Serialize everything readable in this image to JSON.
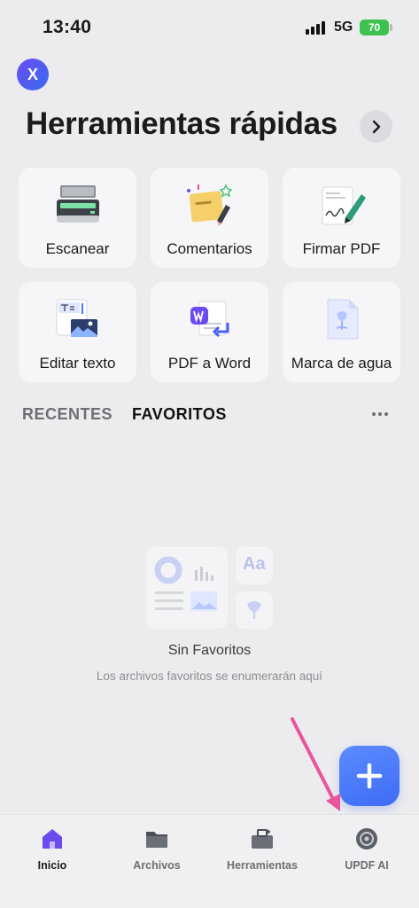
{
  "status_bar": {
    "time": "13:40",
    "network": "5G",
    "battery": "70"
  },
  "profile": {
    "initial": "X"
  },
  "header": {
    "title": "Herramientas rápidas"
  },
  "tools": [
    {
      "label": "Escanear",
      "icon": "scanner-icon"
    },
    {
      "label": "Comentarios",
      "icon": "sticky-note-icon"
    },
    {
      "label": "Firmar PDF",
      "icon": "sign-pen-icon"
    },
    {
      "label": "Editar texto",
      "icon": "edit-text-icon"
    },
    {
      "label": "PDF a Word",
      "icon": "pdf-to-word-icon"
    },
    {
      "label": "Marca de agua",
      "icon": "watermark-icon"
    }
  ],
  "tabs": {
    "recent": "RECENTES",
    "favorites": "FAVORITOS"
  },
  "empty_state": {
    "title": "Sin Favoritos",
    "subtitle": "Los archivos favoritos se enumerarán aquí",
    "illustration_text": "Aa"
  },
  "fab": {
    "icon": "plus-icon"
  },
  "tabbar": [
    {
      "label": "Inicio",
      "icon": "home-icon",
      "active": true
    },
    {
      "label": "Archivos",
      "icon": "folder-icon",
      "active": false
    },
    {
      "label": "Herramientas",
      "icon": "toolbox-icon",
      "active": false
    },
    {
      "label": "UPDF AI",
      "icon": "ai-icon",
      "active": false
    }
  ],
  "colors": {
    "accent": "#4a78f7",
    "annotation_arrow": "#e8559c",
    "active_tab": "#6b4bf0"
  }
}
